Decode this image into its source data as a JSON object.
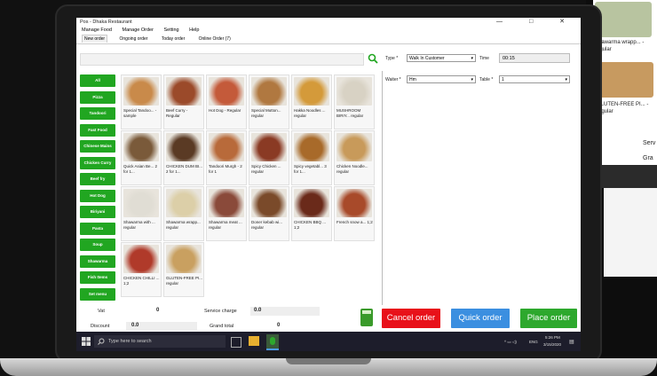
{
  "window": {
    "title": "Pos - Dhaka Restaurant",
    "controls": [
      "—",
      "□",
      "✕"
    ]
  },
  "menu": [
    "Manage Food",
    "Manage Order",
    "Setting",
    "Help"
  ],
  "tabs": [
    "New order",
    "Ongoing order",
    "Today order",
    "Online Order (7)"
  ],
  "categories": [
    "All",
    "Pizza",
    "Tandoori",
    "Fast Food",
    "Chinese Mains",
    "Chicken Curry",
    "Beef fry",
    "Hot Dog",
    "Biriyani",
    "Pasta",
    "Soup",
    "Shawarma",
    "Fish Items",
    "Set menu"
  ],
  "foods": [
    {
      "label": "Special Tandoo... -sample",
      "color": "#c98a4a"
    },
    {
      "label": "Beef Curry - Regular",
      "color": "#9b4a2a"
    },
    {
      "label": "Hot Dog - Regular",
      "color": "#c45a3a"
    },
    {
      "label": "Special Mutton... regular",
      "color": "#b07840"
    },
    {
      "label": "Hakka Noodles ... regular",
      "color": "#d49a3a"
    },
    {
      "label": "MUSHROOM BIRIY... regular",
      "color": "#d8d2c4"
    },
    {
      "label": "Quick Asian Be... 2 for 1...",
      "color": "#7a5a3a"
    },
    {
      "label": "CHICKEN DUM BI... 2 for 1...",
      "color": "#5a3a24"
    },
    {
      "label": "Tandoori Murgh - 2 for 1",
      "color": "#b86a3a"
    },
    {
      "label": "Spicy Chicken ... regular",
      "color": "#8a3a24"
    },
    {
      "label": "Spicy vegetabl... 3 for 1...",
      "color": "#a86a2a"
    },
    {
      "label": "Chicken Noodle... regular",
      "color": "#c89a5a"
    },
    {
      "label": "Shawarma with ... regular",
      "color": "#e0ddd4"
    },
    {
      "label": "Shawarma wrapp... regular",
      "color": "#dccfa8"
    },
    {
      "label": "Shawarma meat ... regular",
      "color": "#8a4a3a"
    },
    {
      "label": "Doner kebab wi... regular",
      "color": "#7a4a2a"
    },
    {
      "label": "CHICKEN BBQ ... 1;2",
      "color": "#6a2a1a"
    },
    {
      "label": "French snow a... 1;2",
      "color": "#a84a2a"
    },
    {
      "label": "CHICKEN CHILLI ... 1;2",
      "color": "#b03a2a"
    },
    {
      "label": "GLUTEN-FREE PI... regular",
      "color": "#c9a060"
    }
  ],
  "order": {
    "type_label": "Type *",
    "type_value": "Walk In Customer",
    "time_label": "Time",
    "time_value": "00:15",
    "waiter_label": "Waiter *",
    "waiter_value": "Hm",
    "table_label": "Table *",
    "table_value": "1"
  },
  "footer": {
    "vat_label": "Vat",
    "vat_value": "0",
    "service_label": "Service charge",
    "service_value": "0.0",
    "discount_label": "Discount",
    "discount_value": "0.0",
    "grand_label": "Grand total",
    "grand_value": "0"
  },
  "buttons": {
    "cancel": "Cancel order",
    "quick": "Quick order",
    "place": "Place order"
  },
  "taskbar": {
    "search_placeholder": "Type here to search",
    "time": "5:26 PM",
    "date": "3/15/2020",
    "lang": "ENG"
  },
  "background": {
    "items": [
      "Shawarma wrapp... - regular",
      "GLUTEN-FREE PI... - regular"
    ],
    "partial": [
      "Serv",
      "Gra"
    ]
  },
  "colors": {
    "green": "#21a621",
    "red": "#e8111a",
    "blue": "#3b8fe0",
    "place": "#2da82d",
    "taskbar": "#1d1d2b"
  }
}
